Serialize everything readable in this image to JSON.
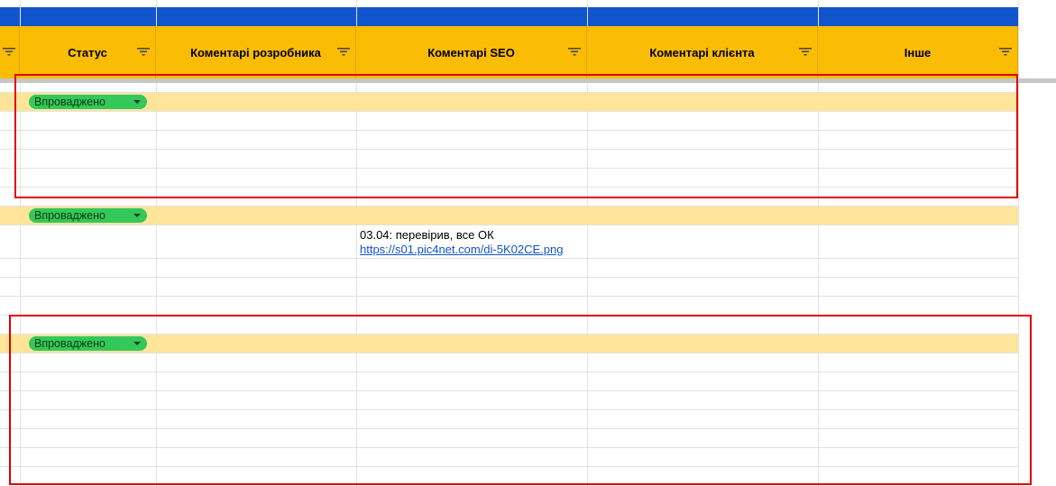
{
  "headers": {
    "status": "Статус",
    "dev_comments": "Коментарі розробника",
    "seo_comments": "Коментарі SEO",
    "client_comments": "Коментарі клієнта",
    "other": "Інше"
  },
  "rows": [
    {
      "status": "Впроваджено"
    },
    {
      "status": "Впроваджено",
      "seo_comment": "03.04: перевірив, все ОК",
      "seo_link": "https://s01.pic4net.com/di-5K02CE.png"
    },
    {
      "status": "Впроваджено"
    }
  ],
  "colors": {
    "header_bg": "#fbbc04",
    "band_bg": "#1155cc",
    "highlight_row": "#fee59a",
    "status_chip": "#34c759",
    "annotation_box": "#e00000"
  },
  "icons": {
    "filter": "filter-icon",
    "dropdown": "chevron-down-icon"
  }
}
